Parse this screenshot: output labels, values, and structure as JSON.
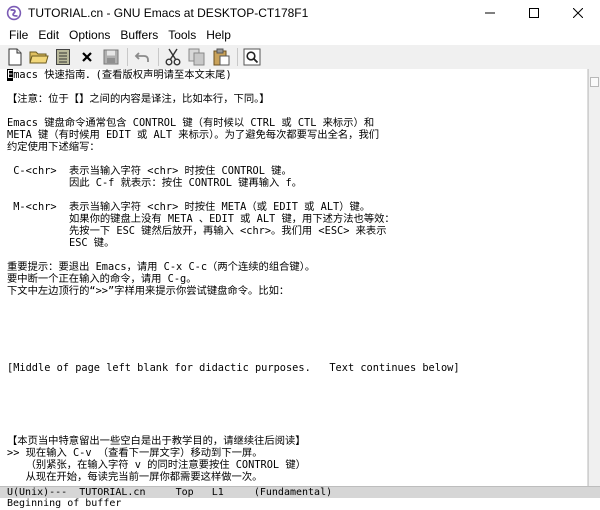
{
  "window": {
    "title": "TUTORIAL.cn - GNU Emacs at DESKTOP-CT178F1"
  },
  "menu": {
    "items": [
      "File",
      "Edit",
      "Options",
      "Buffers",
      "Tools",
      "Help"
    ]
  },
  "toolbar": {
    "buttons": [
      "new-file-icon",
      "open-folder-icon",
      "dired-icon",
      "close-icon",
      "save-icon",
      "undo-icon",
      "cut-icon",
      "copy-icon",
      "paste-icon",
      "search-icon"
    ]
  },
  "buffer": {
    "cursor_char": "E",
    "lines": [
      "macs 快速指南．(查看版权声明请至本文末尾)",
      "",
      "【注意：位于【】之间的内容是译注，比如本行，下同。】",
      "",
      "Emacs 键盘命令通常包含 CONTROL 键（有时候以 CTRL 或 CTL 来标示）和",
      "META 键（有时候用 EDIT 或 ALT 来标示）。为了避免每次都要写出全名，我们",
      "约定使用下述缩写：",
      "",
      " C-<chr>  表示当输入字符 <chr> 时按住 CONTROL 键。",
      "          因此 C-f 就表示：按住 CONTROL 键再输入 f。",
      "",
      " M-<chr>  表示当输入字符 <chr> 时按住 META（或 EDIT 或 ALT）键。",
      "          如果你的键盘上没有 META 、EDIT 或 ALT 键，用下述方法也等效：",
      "          先按一下 ESC 键然后放开，再输入 <chr>。我们用 <ESC> 来表示",
      "          ESC 键。",
      "",
      "重要提示：要退出 Emacs，请用 C-x C-c（两个连续的组合键）。",
      "要中断一个正在输入的命令，请用 C-g。",
      "下文中左边顶行的“>>”字样用来提示你尝试键盘命令。比如：",
      "",
      "",
      "",
      "",
      "",
      "[Middle of page left blank for didactic purposes.   Text continues below]",
      "",
      "",
      "",
      "",
      "",
      "【本页当中特意留出一些空白是出于教学目的，请继续往后阅读】",
      ">> 现在输入 C-v （查看下一屏文字）移动到下一屏。",
      "   （别紧张，在输入字符 v 的同时注意要按住 CONTROL 键）",
      "   从现在开始，每读完当前一屏你都需要这样做一次。"
    ]
  },
  "modeline": {
    "text": "U(Unix)---  TUTORIAL.cn     Top   L1     (Fundamental)"
  },
  "echo_area": {
    "text": "Beginning of buffer"
  }
}
